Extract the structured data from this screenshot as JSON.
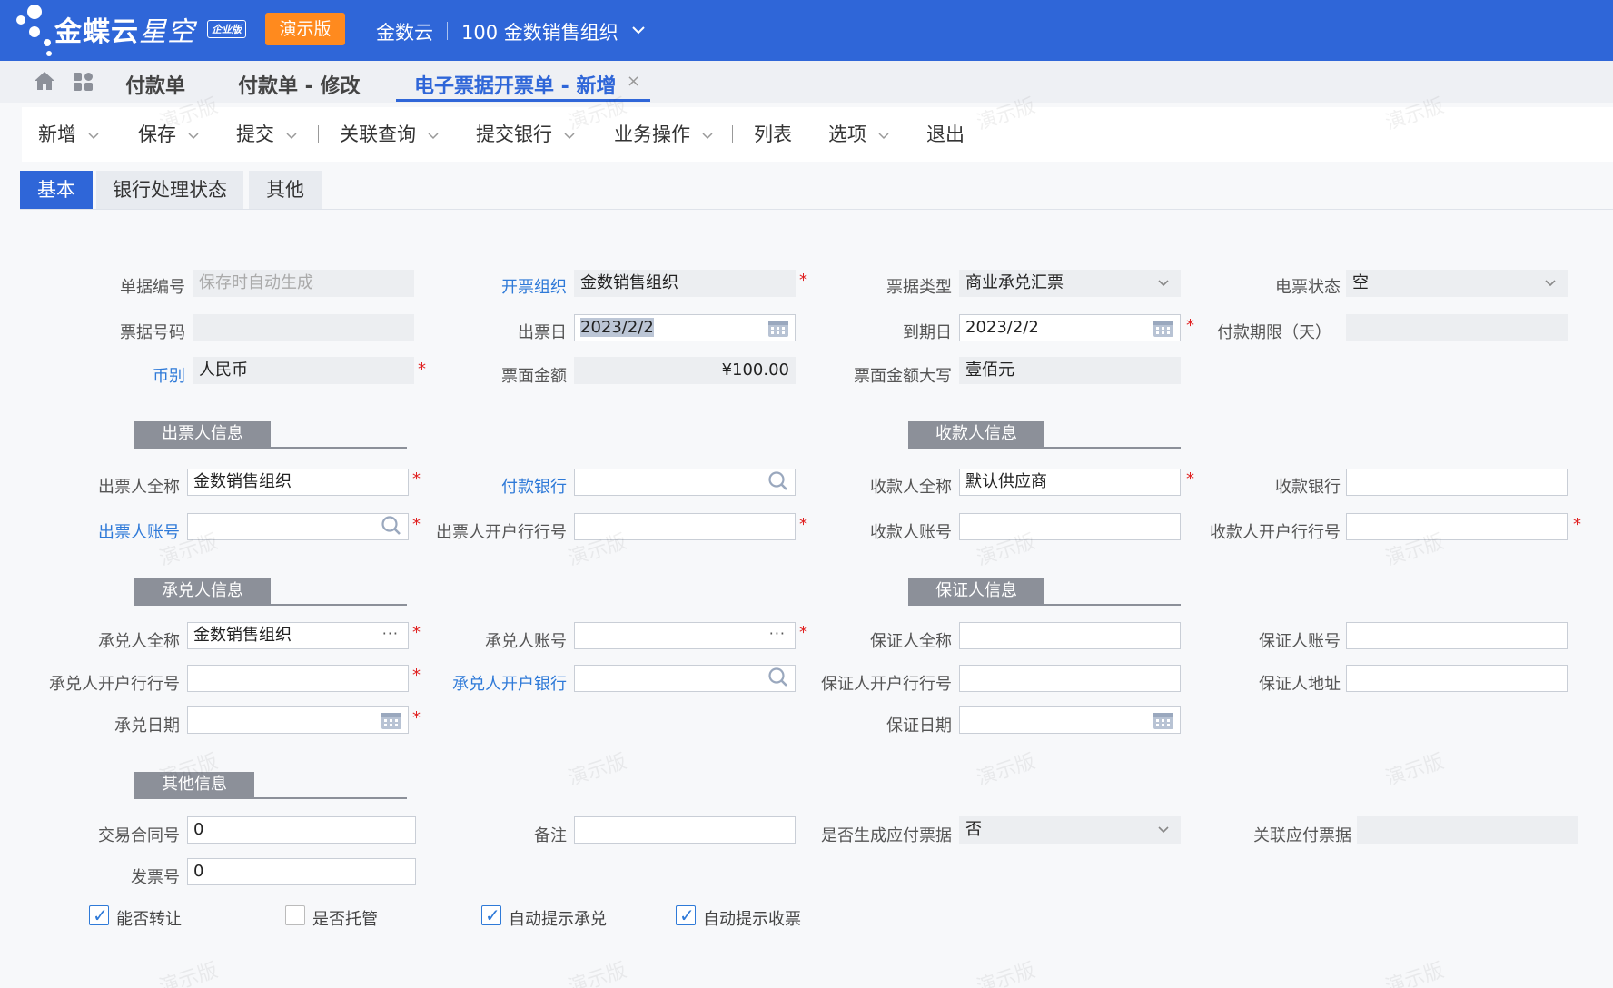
{
  "header": {
    "brand": "金蝶云",
    "brand_sub": "星空",
    "edition": "企业版",
    "demo_badge": "演示版",
    "tenant": "金数云",
    "org": "100 金数销售组织"
  },
  "doc_tabs": [
    "付款单",
    "付款单 - 修改",
    "电子票据开票单 - 新增"
  ],
  "toolbar": [
    "新增",
    "保存",
    "提交",
    "关联查询",
    "提交银行",
    "业务操作",
    "列表",
    "选项",
    "退出"
  ],
  "form_tabs": [
    "基本",
    "银行处理状态",
    "其他"
  ],
  "watermark": "演示版",
  "basic": {
    "bill_no_label": "单据编号",
    "bill_no_placeholder": "保存时自动生成",
    "issue_org_label": "开票组织",
    "issue_org_value": "金数销售组织",
    "bill_type_label": "票据类型",
    "bill_type_value": "商业承兑汇票",
    "e_status_label": "电票状态",
    "e_status_value": "空",
    "bill_code_label": "票据号码",
    "bill_code_value": "",
    "issue_date_label": "出票日",
    "issue_date_value": "2023/2/2",
    "due_date_label": "到期日",
    "due_date_value": "2023/2/2",
    "pay_term_label": "付款期限（天）",
    "pay_term_value": "",
    "currency_label": "币别",
    "currency_value": "人民币",
    "amount_label": "票面金额",
    "amount_value": "¥100.00",
    "amount_cn_label": "票面金额大写",
    "amount_cn_value": "壹佰元"
  },
  "drawer": {
    "title": "出票人信息",
    "name_label": "出票人全称",
    "name_value": "金数销售组织",
    "bank_label": "付款银行",
    "bank_value": "",
    "account_label": "出票人账号",
    "account_value": "",
    "bank_no_label": "出票人开户行行号",
    "bank_no_value": ""
  },
  "payee": {
    "title": "收款人信息",
    "name_label": "收款人全称",
    "name_value": "默认供应商",
    "bank_label": "收款银行",
    "bank_value": "",
    "account_label": "收款人账号",
    "account_value": "",
    "bank_no_label": "收款人开户行行号",
    "bank_no_value": ""
  },
  "acceptor": {
    "title": "承兑人信息",
    "name_label": "承兑人全称",
    "name_value": "金数销售组织",
    "account_label": "承兑人账号",
    "account_value": "",
    "bank_no_label": "承兑人开户行行号",
    "bank_no_value": "",
    "bank_label": "承兑人开户银行",
    "bank_value": "",
    "date_label": "承兑日期",
    "date_value": ""
  },
  "guarantor": {
    "title": "保证人信息",
    "name_label": "保证人全称",
    "name_value": "",
    "account_label": "保证人账号",
    "account_value": "",
    "bank_no_label": "保证人开户行行号",
    "bank_no_value": "",
    "address_label": "保证人地址",
    "address_value": "",
    "date_label": "保证日期",
    "date_value": ""
  },
  "other": {
    "title": "其他信息",
    "contract_label": "交易合同号",
    "contract_value": "0",
    "remark_label": "备注",
    "remark_value": "",
    "gen_payable_label": "是否生成应付票据",
    "gen_payable_value": "否",
    "related_label": "关联应付票据",
    "related_value": "",
    "invoice_label": "发票号",
    "invoice_value": "0"
  },
  "checkboxes": [
    {
      "label": "能否转让",
      "checked": true
    },
    {
      "label": "是否托管",
      "checked": false
    },
    {
      "label": "自动提示承兑",
      "checked": true
    },
    {
      "label": "自动提示收票",
      "checked": true
    }
  ],
  "colors": {
    "primary": "#2f66d8",
    "accent": "#ff8a1e",
    "required": "#e02020",
    "link": "#2f7ad8"
  }
}
